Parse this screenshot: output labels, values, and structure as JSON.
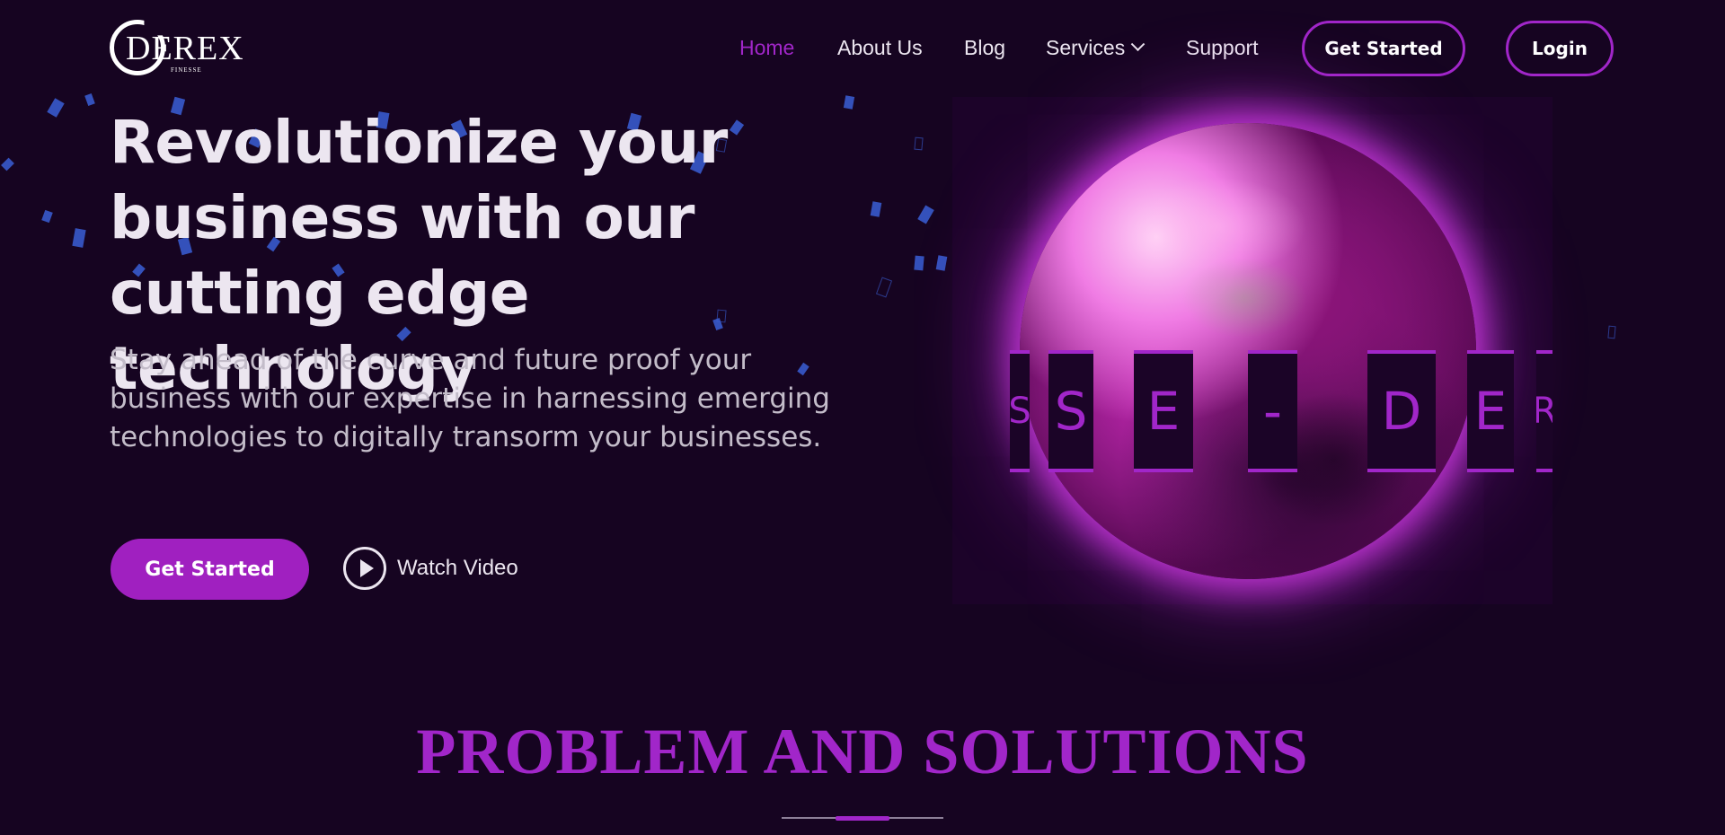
{
  "brand": {
    "logo_text": "DEREX",
    "logo_tagline": "FINESSE"
  },
  "nav": {
    "items": [
      {
        "label": "Home"
      },
      {
        "label": "About Us"
      },
      {
        "label": "Blog"
      },
      {
        "label": "Services"
      },
      {
        "label": "Support"
      }
    ],
    "active": "Home",
    "get_started_label": "Get Started",
    "login_label": "Login"
  },
  "hero": {
    "title_line1": "Revolutionize your",
    "title_line2": "business with our",
    "title_line3": "cutting edge technology",
    "subtitle_line1": "Stay ahead of the curve and future proof your",
    "subtitle_line2": "business with our expertise in harnessing emerging",
    "subtitle_line3": "technologies to digitally transorm your businesses.",
    "cta_label": "Get Started",
    "video_label": "Watch Video"
  },
  "orb_tiles": [
    "S",
    "S",
    "E",
    "-",
    "D",
    "E",
    "R"
  ],
  "section": {
    "title": "PROBLEM AND SOLUTIONS"
  },
  "colors": {
    "accent": "#a126c9",
    "background": "#160421",
    "text": "#ece6f0",
    "confetti": "#3a5fd6"
  }
}
